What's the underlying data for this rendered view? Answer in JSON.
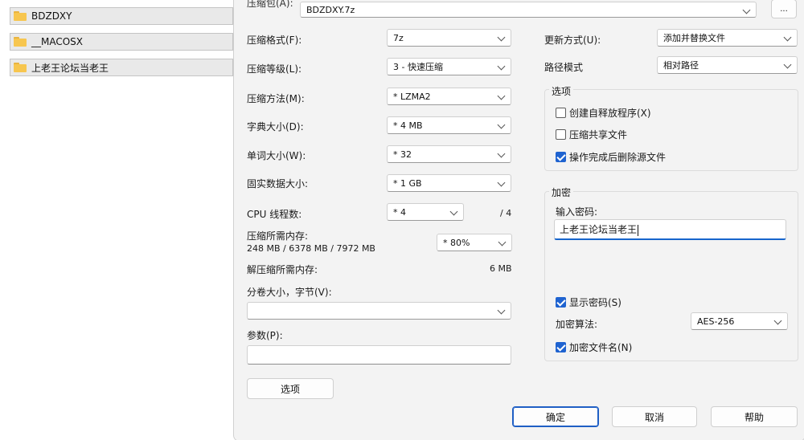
{
  "files": [
    {
      "name": "BDZDXY"
    },
    {
      "name": "__MACOSX"
    },
    {
      "name": "上老王论坛当老王"
    }
  ],
  "archive": {
    "label": "压缩包(A):",
    "value": "BDZDXY.7z",
    "browse_label": "..."
  },
  "left": {
    "format_label": "压缩格式(F):",
    "format_value": "7z",
    "level_label": "压缩等级(L):",
    "level_value": "3 - 快速压缩",
    "method_label": "压缩方法(M):",
    "method_value": "* LZMA2",
    "dict_label": "字典大小(D):",
    "dict_value": "* 4 MB",
    "word_label": "单词大小(W):",
    "word_value": "* 32",
    "solid_label": "固实数据大小:",
    "solid_value": "* 1 GB",
    "cpu_label": "CPU 线程数:",
    "cpu_value": "* 4",
    "cpu_max": "/ 4",
    "mem_label": "压缩所需内存:",
    "mem_detail": "248 MB / 6378 MB / 7972 MB",
    "mem_value": "* 80%",
    "decomp_label": "解压缩所需内存:",
    "decomp_value": "6 MB",
    "split_label": "分卷大小，字节(V):",
    "split_value": "",
    "params_label": "参数(P):",
    "options_button": "选项"
  },
  "right": {
    "update_label": "更新方式(U):",
    "update_value": "添加并替换文件",
    "path_label": "路径模式",
    "path_value": "相对路径",
    "options_group": "选项",
    "opt_sfx": "创建自释放程序(X)",
    "opt_sfx_checked": false,
    "opt_shared": "压缩共享文件",
    "opt_shared_checked": false,
    "opt_delete": "操作完成后删除源文件",
    "opt_delete_checked": true,
    "encrypt_group": "加密",
    "password_label": "输入密码:",
    "password_value": "上老王论坛当老王",
    "show_password": "显示密码(S)",
    "show_password_checked": true,
    "enc_method_label": "加密算法:",
    "enc_method_value": "AES-256",
    "enc_names": "加密文件名(N)",
    "enc_names_checked": true
  },
  "buttons": {
    "ok": "确定",
    "cancel": "取消",
    "help": "帮助"
  },
  "colors": {
    "accent": "#1f63d0",
    "folder": "#f7c64f",
    "dialog_bg": "#f3f3f3"
  }
}
